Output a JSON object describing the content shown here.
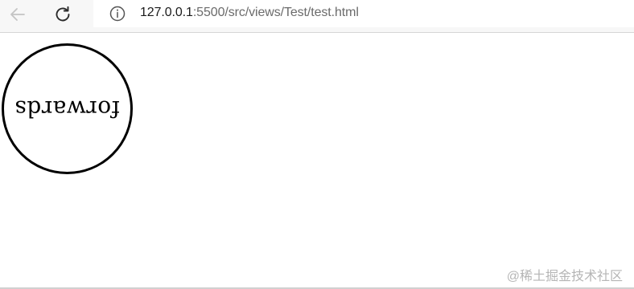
{
  "browser": {
    "back_icon": "arrow-left-icon",
    "reload_icon": "reload-icon",
    "info_icon": "info-icon",
    "url_host": "127.0.0.1",
    "url_rest": ":5500/src/views/Test/test.html"
  },
  "page": {
    "circle_text": "forwards"
  },
  "watermark": {
    "text": "@稀土掘金技术社区"
  }
}
